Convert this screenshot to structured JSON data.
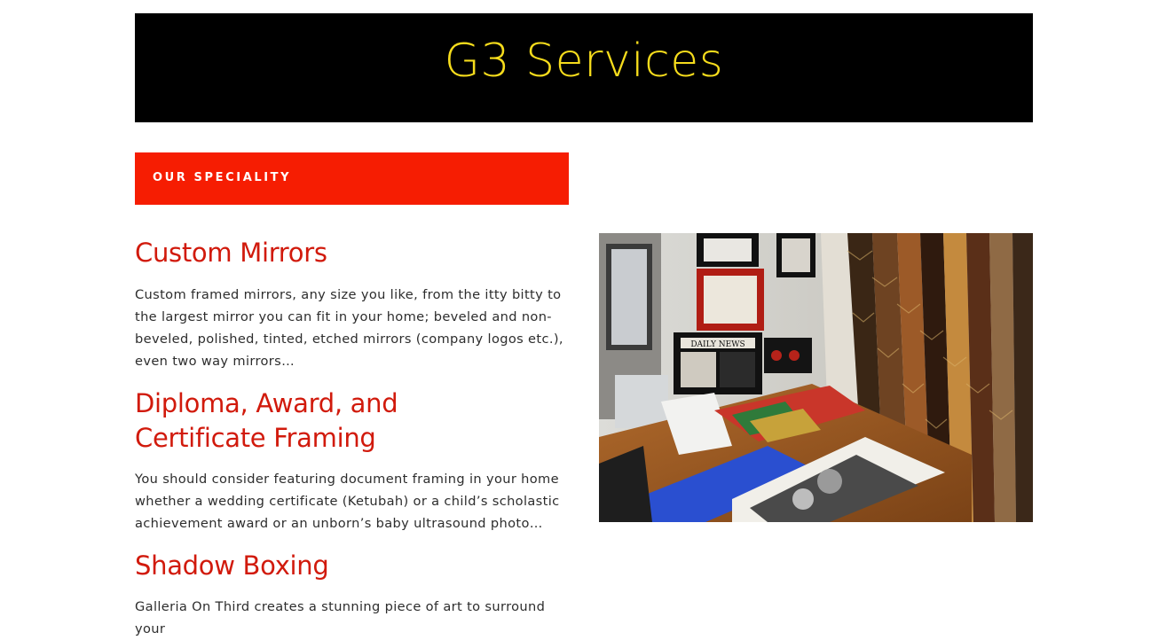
{
  "header": {
    "site_title": "G3 Services"
  },
  "section": {
    "banner_label": "OUR SPECIALITY"
  },
  "services": [
    {
      "title": "Custom Mirrors",
      "description": "Custom framed mirrors, any size you like, from the itty bitty to the largest mirror you can fit in your home; beveled and non-beveled, polished, tinted, etched mirrors (company logos etc.), even two way mirrors…"
    },
    {
      "title": "Diploma, Award, and Certificate Framing",
      "description": "You should consider featuring document framing in your home whether a wedding certificate (Ketubah) or a child’s scholastic achievement award or an unborn’s baby ultrasound photo…"
    },
    {
      "title": "Shadow Boxing",
      "description": "Galleria On Third creates a stunning piece of art to surround your"
    }
  ],
  "photo": {
    "newspaper_sign": "DAILY NEWS"
  },
  "colors": {
    "header_bg": "#000000",
    "title_yellow": "#f6dc1c",
    "banner_red": "#f61d02",
    "heading_red": "#d11a0c",
    "body_text": "#2d2d2d"
  }
}
